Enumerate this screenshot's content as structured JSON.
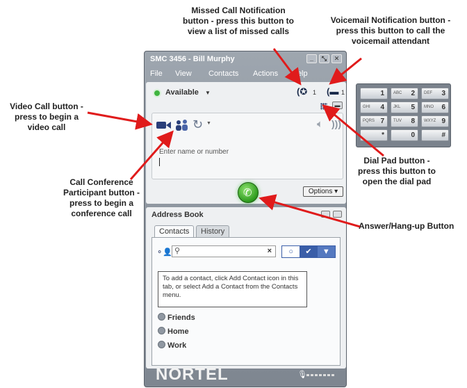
{
  "annotations": {
    "missed": "Missed Call Notification button - press this button to view a list of missed calls",
    "voicemail": "Voicemail Notification button - press this button to call the voicemail attendant",
    "video": "Video Call button - press to begin a video call",
    "dialpad": "Dial Pad button - press this button to open the dial pad",
    "conference": "Call Conference Participant button - press to begin a conference call",
    "answer": "Answer/Hang-up Button"
  },
  "window": {
    "title": "SMC 3456 - Bill Murphy",
    "menu": [
      "File",
      "View",
      "Contacts",
      "Actions",
      "Help"
    ],
    "status": "Available",
    "missed_count": "1",
    "voicemail_count": "1",
    "input_placeholder": "Enter name or number",
    "options_label": "Options",
    "address_book_title": "Address Book",
    "tabs": [
      "Contacts",
      "History"
    ],
    "info_text": "To add a contact, click Add Contact icon in this tab, or select Add a Contact from the Contacts menu.",
    "groups": [
      "Friends",
      "Home",
      "Work"
    ],
    "logo": "NORTEL"
  },
  "dialpad": {
    "keys": [
      {
        "sub": "",
        "digit": "1"
      },
      {
        "sub": "ABC",
        "digit": "2"
      },
      {
        "sub": "DEF",
        "digit": "3"
      },
      {
        "sub": "GHI",
        "digit": "4"
      },
      {
        "sub": "JKL",
        "digit": "5"
      },
      {
        "sub": "MNO",
        "digit": "6"
      },
      {
        "sub": "PQRS",
        "digit": "7"
      },
      {
        "sub": "TUV",
        "digit": "8"
      },
      {
        "sub": "WXYZ",
        "digit": "9"
      },
      {
        "sub": "",
        "digit": "*"
      },
      {
        "sub": "",
        "digit": "0"
      },
      {
        "sub": "",
        "digit": "#"
      }
    ]
  },
  "colors": {
    "accent_blue": "#3a5ea8",
    "status_green": "#3fb43f",
    "arrow_red": "#e01b1b"
  }
}
